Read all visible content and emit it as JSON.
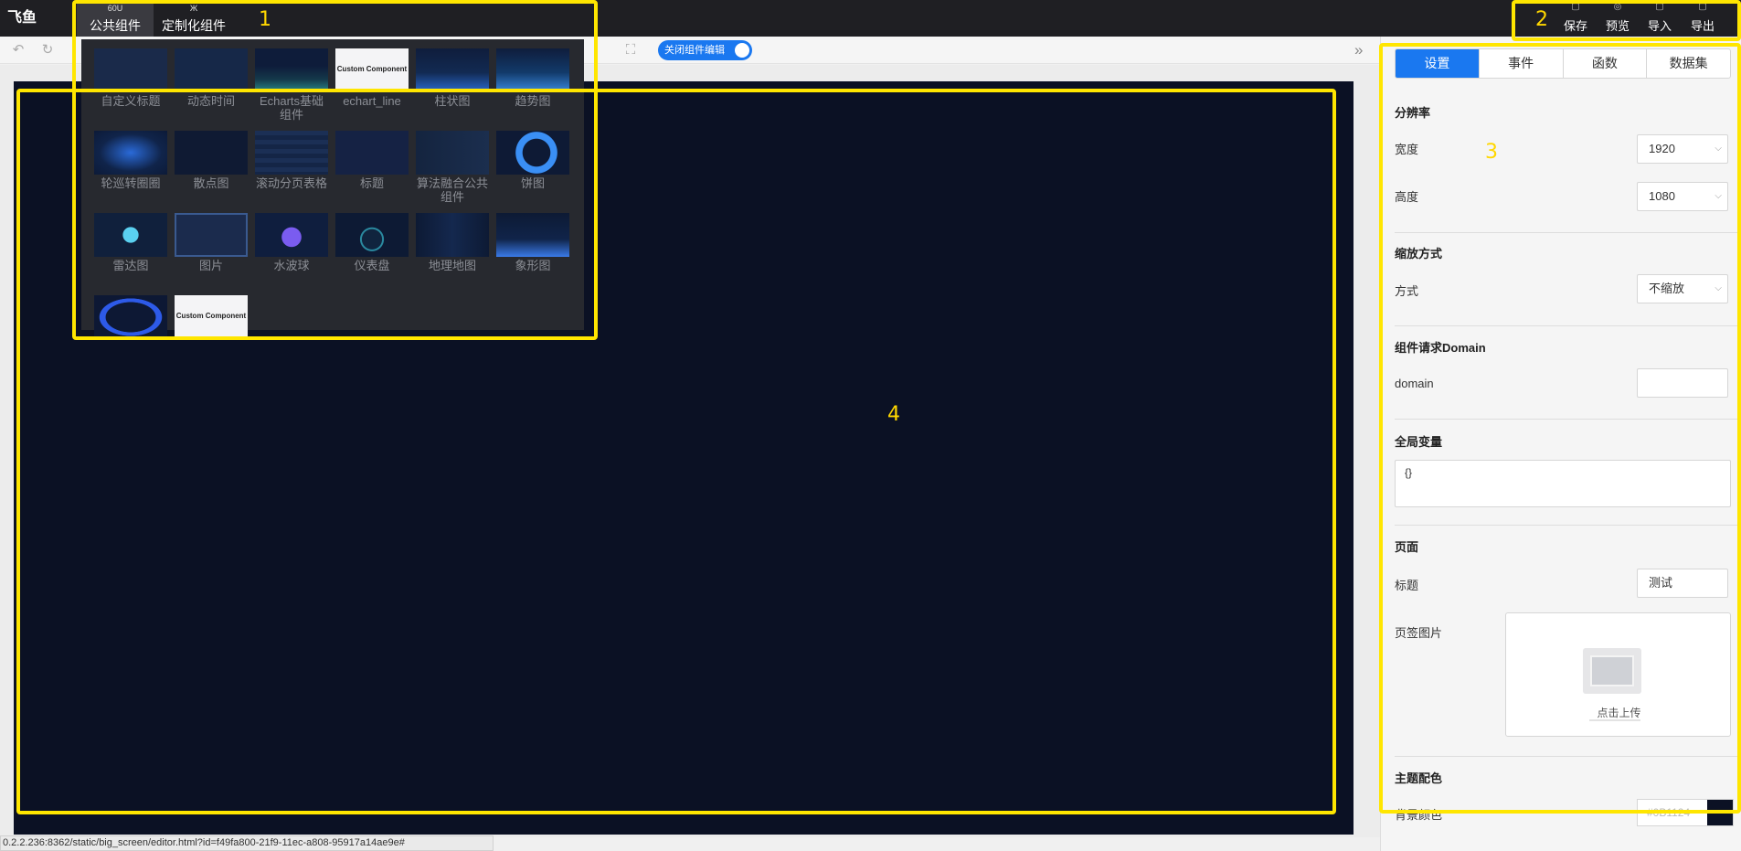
{
  "app": {
    "title": "飞鱼"
  },
  "top_tabs": [
    {
      "label": "公共组件",
      "icon_text": "60U",
      "icon": "components-icon",
      "active": true
    },
    {
      "label": "定制化组件",
      "icon_text": "Ж",
      "icon": "custom-components-icon",
      "active": false
    }
  ],
  "top_actions": [
    {
      "label": "保存",
      "icon": "save-icon",
      "glyph": "▢"
    },
    {
      "label": "预览",
      "icon": "preview-icon",
      "glyph": "◎"
    },
    {
      "label": "导入",
      "icon": "import-icon",
      "glyph": "▢"
    },
    {
      "label": "导出",
      "icon": "export-icon",
      "glyph": "▢"
    }
  ],
  "toolbar": {
    "undo_glyph": "↶",
    "redo_glyph": "↻",
    "fullscreen_glyph": "⛶",
    "toggle_label": "关闭组件编辑",
    "toggle_on": true,
    "collapse_glyph": "»"
  },
  "components": [
    {
      "label": "自定义标题",
      "thumb": "custom-title"
    },
    {
      "label": "动态时间",
      "thumb": "dynamic-time"
    },
    {
      "label": "Echarts基础组件",
      "thumb": "echarts-basic"
    },
    {
      "label": "echart_line",
      "thumb": "custom-component"
    },
    {
      "label": "柱状图",
      "thumb": "bar-chart"
    },
    {
      "label": "趋势图",
      "thumb": "trend-chart"
    },
    {
      "label": "轮巡转圈圈",
      "thumb": "carousel-circle"
    },
    {
      "label": "散点图",
      "thumb": "scatter-chart"
    },
    {
      "label": "滚动分页表格",
      "thumb": "scroll-table"
    },
    {
      "label": "标题",
      "thumb": "title"
    },
    {
      "label": "算法融合公共组件",
      "thumb": "algorithm"
    },
    {
      "label": "饼图",
      "thumb": "pie-chart"
    },
    {
      "label": "雷达图",
      "thumb": "radar-chart"
    },
    {
      "label": "图片",
      "thumb": "image"
    },
    {
      "label": "水波球",
      "thumb": "liquid-ball"
    },
    {
      "label": "仪表盘",
      "thumb": "gauge"
    },
    {
      "label": "地理地图",
      "thumb": "geo-map"
    },
    {
      "label": "象形图",
      "thumb": "pictorial-chart"
    },
    {
      "label": "",
      "thumb": "ring"
    },
    {
      "label": "",
      "thumb": "custom-component"
    }
  ],
  "custom_component_text": "Custom Component",
  "side_tabs": [
    {
      "label": "设置",
      "active": true
    },
    {
      "label": "事件",
      "active": false
    },
    {
      "label": "函数",
      "active": false
    },
    {
      "label": "数据集",
      "active": false
    }
  ],
  "settings": {
    "resolution": {
      "title": "分辨率",
      "width_label": "宽度",
      "width_value": "1920",
      "height_label": "高度",
      "height_value": "1080"
    },
    "scale": {
      "title": "缩放方式",
      "mode_label": "方式",
      "mode_value": "不缩放"
    },
    "domain": {
      "title": "组件请求Domain",
      "label": "domain",
      "value": ""
    },
    "globals": {
      "title": "全局变量",
      "value": "{}"
    },
    "page": {
      "title": "页面",
      "title_label": "标题",
      "title_value": "测试",
      "favicon_label": "页签图片",
      "upload_text": "点击上传"
    },
    "theme": {
      "title": "主题配色",
      "bg_label": "背景颜色",
      "bg_value": "#0B1124",
      "bg_color": "#0b1124"
    }
  },
  "status_url": "0.2.2.236:8362/static/big_screen/editor.html?id=f49fa800-21f9-11ec-a808-95917a14ae9e#",
  "annotations": [
    "1",
    "2",
    "3",
    "4"
  ],
  "colors": {
    "accent": "#1a78f0",
    "highlight": "#ffe600",
    "canvas_bg": "#0b1124",
    "topbar_bg": "#1f1f23"
  }
}
